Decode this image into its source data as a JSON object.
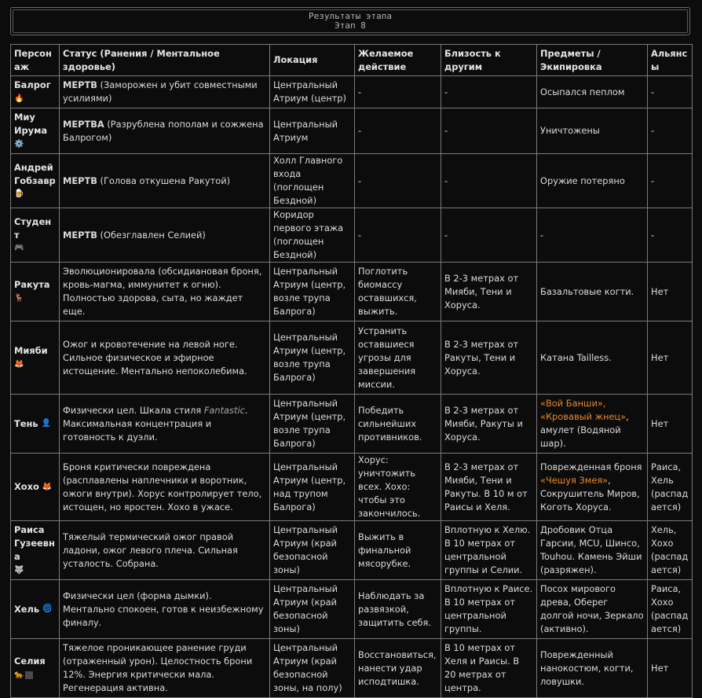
{
  "banner": {
    "title": "Результаты этапа",
    "subtitle": "Этап 8"
  },
  "headers": [
    "Персонаж",
    "Статус (Ранения / Ментальное здоровье)",
    "Локация",
    "Желаемое действие",
    "Близость к другим",
    "Предметы / Экипировка",
    "Альянсы"
  ],
  "icons": {
    "balrog": "🔥",
    "miu": "⚙️",
    "andrey": "🍺",
    "student": "🎮",
    "rakuta": "🦌",
    "miyabi": "🦊",
    "ten": "👤",
    "hoho": "🦊",
    "raisa": "🐺",
    "hel": "🌀",
    "selia": "🐆"
  },
  "rows": [
    {
      "name": "Балрог",
      "status_bold": "МЕРТВ",
      "status_rest": " (Заморожен и убит совместными усилиями)",
      "location": "Центральный Атриум (центр)",
      "action": "-",
      "proximity": "-",
      "items": "Осыпался пеплом",
      "alliance": "-"
    },
    {
      "name": "Миу Ирума",
      "status_bold": "МЕРТВА",
      "status_rest": " (Разрублена пополам и сожжена Балрогом)",
      "location": "Центральный Атриум",
      "action": "-",
      "proximity": "-",
      "items": "Уничтожены",
      "alliance": "-"
    },
    {
      "name": "Андрей Гобзавр",
      "status_bold": "МЕРТВ",
      "status_rest": " (Голова откушена Ракутой)",
      "location": "Холл Главного входа (поглощен Бездной)",
      "action": "-",
      "proximity": "-",
      "items": "Оружие потеряно",
      "alliance": "-"
    },
    {
      "name": "Студент",
      "status_bold": "МЕРТВ",
      "status_rest": " (Обезглавлен Селией)",
      "location": "Коридор первого этажа (поглощен Бездной)",
      "action": "-",
      "proximity": "-",
      "items": "-",
      "alliance": "-"
    },
    {
      "name": "Ракута",
      "status": "Эволюционировала (обсидиановая броня, кровь-магма, иммунитет к огню). Полностью здорова, сыта, но жаждет еще.",
      "location": "Центральный Атриум (центр, возле трупа Балрога)",
      "action": "Поглотить биомассу оставшихся, выжить.",
      "proximity": "В 2-3 метрах от Мияби, Тени и Хоруса.",
      "items": "Базальтовые когти.",
      "alliance": "Нет"
    },
    {
      "name": "Мияби",
      "status": "Ожог и кровотечение на левой ноге. Сильное физическое и эфирное истощение. Ментально непоколебима.",
      "location": "Центральный Атриум (центр, возле трупа Балрога)",
      "action": "Устранить оставшиеся угрозы для завершения миссии.",
      "proximity": "В 2-3 метрах от Ракуты, Тени и Хоруса.",
      "items": "Катана Tailless.",
      "alliance": "Нет"
    },
    {
      "name": "Тень",
      "status_a": "Физически цел. Шкала стиля ",
      "status_italic": "Fantastic",
      "status_b": ". Максимальная концентрация и готовность к дуэли.",
      "location": "Центральный Атриум (центр, возле трупа Балрога)",
      "action": "Победить сильнейших противников.",
      "proximity": "В 2-3 метрах от Мияби, Ракуты и Хоруса.",
      "items_orange1": "«Вой Банши»,",
      "items_orange2": "«Кровавый жнец»",
      "items_tail": ", амулет (Водяной шар).",
      "alliance": "Нет"
    },
    {
      "name": "Хохо",
      "status": "Броня критически повреждена (расплавлены наплечники и воротник, ожоги внутри). Хорус контролирует тело, истощен, но яростен. Хохо в ужасе.",
      "location": "Центральный Атриум (центр, над трупом Балрога)",
      "action": "Хорус: уничтожить всех. Хохо: чтобы это закончилось.",
      "proximity": "В 2-3 метрах от Мияби, Тени и Ракуты. В 10 м от Раисы и Хеля.",
      "items_head": "Поврежденная броня ",
      "items_orange": "«Чешуя Змея»",
      "items_tail": ", Сокрушитель Миров, Коготь Хоруса.",
      "alliance": "Раиса, Хель (распадается)"
    },
    {
      "name": "Раиса Гузеевна",
      "status": "Тяжелый термический ожог правой ладони, ожог левого плеча. Сильная усталость. Собрана.",
      "location": "Центральный Атриум (край безопасной зоны)",
      "action": "Выжить в финальной мясорубке.",
      "proximity": "Вплотную к Хелю. В 10 метрах от центральной группы и Селии.",
      "items": "Дробовик Отца Гарсии, MCU, Шинсо, Touhou. Камень Эйши (разряжен).",
      "alliance": "Хель, Хохо (распадается)"
    },
    {
      "name": "Хель",
      "status": "Физически цел (форма дымки). Ментально спокоен, готов к неизбежному финалу.",
      "location": "Центральный Атриум (край безопасной зоны)",
      "action": "Наблюдать за развязкой, защитить себя.",
      "proximity": "Вплотную к Раисе. В 10 метрах от центральной группы.",
      "items": "Посох мирового древа, Оберег долгой ночи, Зеркало (активно).",
      "alliance": "Раиса, Хохо (распадается)"
    },
    {
      "name": "Селия",
      "status": "Тяжелое проникающее ранение груди (отраженный урон). Целостность брони 12%. Энергия критически мала. Регенерация активна.",
      "location": "Центральный Атриум (край безопасной зоны, на полу)",
      "action": "Восстановиться, нанести удар исподтишка.",
      "proximity": "В 10 метрах от Хеля и Раисы. В 20 метрах от центра.",
      "items": "Поврежденный нанокостюм, когти, ловушки.",
      "alliance": "Нет"
    }
  ]
}
